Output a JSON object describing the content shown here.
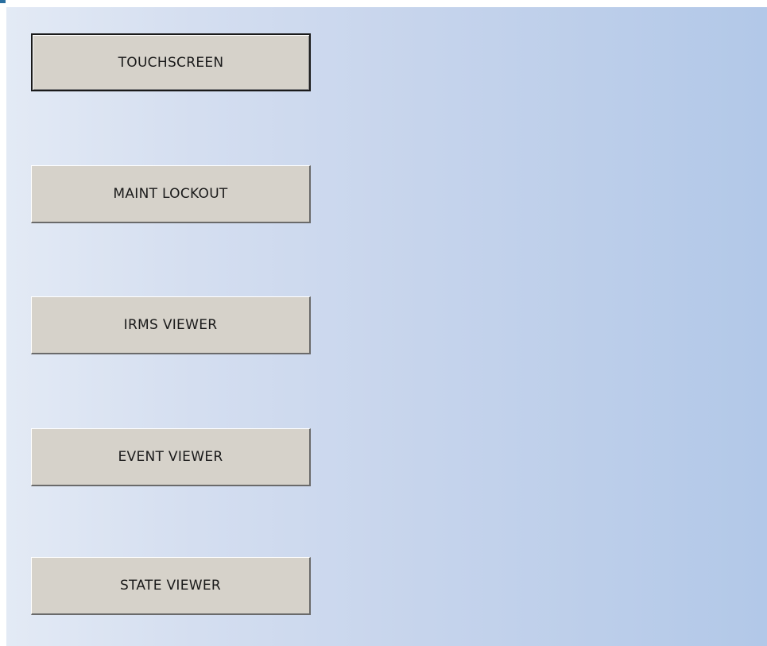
{
  "menu": {
    "buttons": [
      {
        "id": "touchscreen",
        "label": "TOUCHSCREEN",
        "focused": true
      },
      {
        "id": "maint-lockout",
        "label": "MAINT LOCKOUT",
        "focused": false
      },
      {
        "id": "irms-viewer",
        "label": "IRMS VIEWER",
        "focused": false
      },
      {
        "id": "event-viewer",
        "label": "EVENT VIEWER",
        "focused": false
      },
      {
        "id": "state-viewer",
        "label": "STATE VIEWER",
        "focused": false
      }
    ]
  },
  "colors": {
    "button_face": "#d6d2ca",
    "panel_gradient_start": "#e3eaf5",
    "panel_gradient_end": "#b2c8e8",
    "corner_accent": "#2a6fa0"
  }
}
